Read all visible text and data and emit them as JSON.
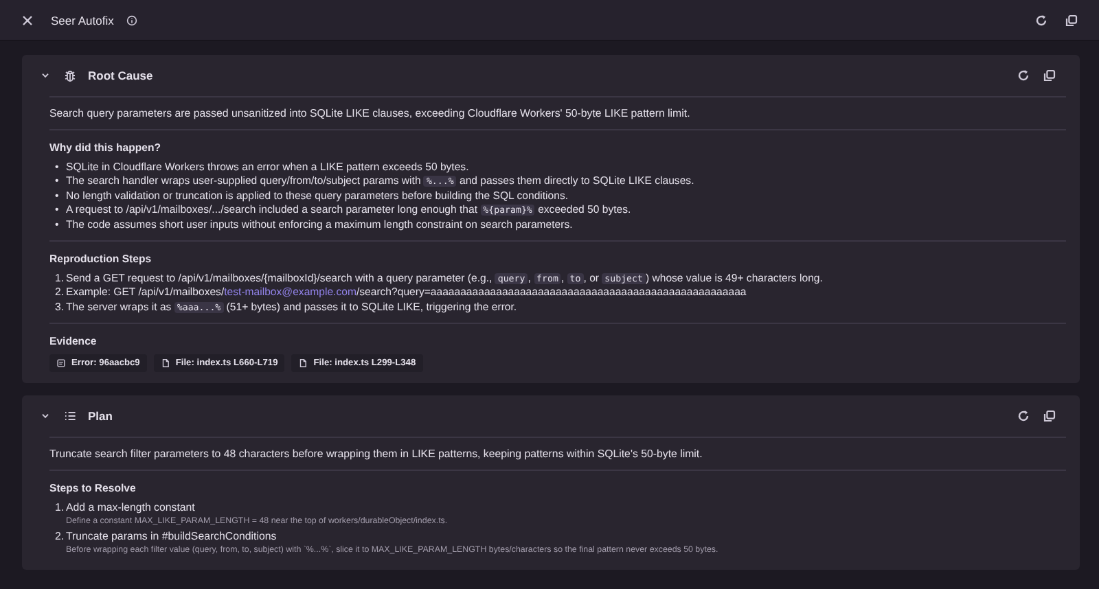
{
  "header": {
    "title": "Seer Autofix"
  },
  "sections": [
    {
      "kind": "root_cause",
      "title": "Root Cause",
      "summary": "Search query parameters are passed unsanitized into SQLite LIKE clauses, exceeding Cloudflare Workers' 50-byte LIKE pattern limit.",
      "blocks": [
        {
          "kind": "bullets",
          "heading": "Why did this happen?",
          "items": [
            {
              "marker": "•",
              "segments": [
                {
                  "kind": "text",
                  "text": "SQLite in Cloudflare Workers throws an error when a LIKE pattern exceeds 50 bytes."
                }
              ]
            },
            {
              "marker": "•",
              "segments": [
                {
                  "kind": "text",
                  "text": "The search handler wraps user-supplied query/from/to/subject params with "
                },
                {
                  "kind": "code",
                  "text": "%...%"
                },
                {
                  "kind": "text",
                  "text": " and passes them directly to SQLite LIKE clauses."
                }
              ]
            },
            {
              "marker": "•",
              "segments": [
                {
                  "kind": "text",
                  "text": "No length validation or truncation is applied to these query parameters before building the SQL conditions."
                }
              ]
            },
            {
              "marker": "•",
              "segments": [
                {
                  "kind": "text",
                  "text": "A request to /api/v1/mailboxes/.../search included a search parameter long enough that "
                },
                {
                  "kind": "code",
                  "text": "%{param}%"
                },
                {
                  "kind": "text",
                  "text": " exceeded 50 bytes."
                }
              ]
            },
            {
              "marker": "•",
              "segments": [
                {
                  "kind": "text",
                  "text": "The code assumes short user inputs without enforcing a maximum length constraint on search parameters."
                }
              ]
            }
          ]
        },
        {
          "kind": "steps",
          "heading": "Reproduction Steps",
          "items": [
            {
              "marker": "1.",
              "segments": [
                {
                  "kind": "text",
                  "text": "Send a GET request to /api/v1/mailboxes/{mailboxId}/search with a query parameter (e.g., "
                },
                {
                  "kind": "code",
                  "text": "query"
                },
                {
                  "kind": "text",
                  "text": ", "
                },
                {
                  "kind": "code",
                  "text": "from"
                },
                {
                  "kind": "text",
                  "text": ", "
                },
                {
                  "kind": "code",
                  "text": "to"
                },
                {
                  "kind": "text",
                  "text": ", or "
                },
                {
                  "kind": "code",
                  "text": "subject"
                },
                {
                  "kind": "text",
                  "text": ") whose value is 49+ characters long."
                }
              ]
            },
            {
              "marker": "2.",
              "segments": [
                {
                  "kind": "text",
                  "text": "Example: GET /api/v1/mailboxes/"
                },
                {
                  "kind": "link",
                  "text": "test-mailbox@example.com"
                },
                {
                  "kind": "text",
                  "text": "/search?query=aaaaaaaaaaaaaaaaaaaaaaaaaaaaaaaaaaaaaaaaaaaaaaaaaaaaa"
                }
              ]
            },
            {
              "marker": "3.",
              "segments": [
                {
                  "kind": "text",
                  "text": "The server wraps it as "
                },
                {
                  "kind": "code",
                  "text": "%aaa...%"
                },
                {
                  "kind": "text",
                  "text": " (51+ bytes) and passes it to SQLite LIKE, triggering the error."
                }
              ]
            }
          ]
        },
        {
          "kind": "evidence",
          "heading": "Evidence",
          "items": [
            {
              "kind": "error",
              "label": "Error: 96aacbc9"
            },
            {
              "kind": "file",
              "label": "File: index.ts L660-L719"
            },
            {
              "kind": "file",
              "label": "File: index.ts L299-L348"
            }
          ]
        }
      ]
    },
    {
      "kind": "plan",
      "title": "Plan",
      "summary": "Truncate search filter parameters to 48 characters before wrapping them in LIKE patterns, keeping patterns within SQLite's 50-byte limit.",
      "blocks": [
        {
          "kind": "resolve",
          "heading": "Steps to Resolve",
          "items": [
            {
              "marker": "1.",
              "title": "Add a max-length constant",
              "description": "Define a constant MAX_LIKE_PARAM_LENGTH = 48 near the top of workers/durableObject/index.ts."
            },
            {
              "marker": "2.",
              "title": "Truncate params in #buildSearchConditions",
              "description": "Before wrapping each filter value (query, from, to, subject) with `%...%`, slice it to MAX_LIKE_PARAM_LENGTH bytes/characters so the final pattern never exceeds 50 bytes."
            }
          ]
        }
      ]
    }
  ]
}
